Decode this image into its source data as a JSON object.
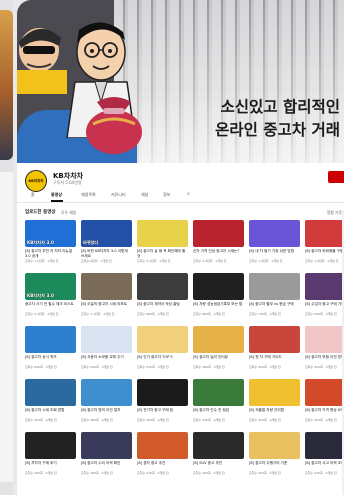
{
  "banner": {
    "headline_line1": "소신있고 합리적인",
    "headline_line2": "온라인 중고차 거래"
  },
  "channel": {
    "avatar_text": "KB차차차",
    "name": "KB차차차",
    "subtitle": "구독자 5.64만명"
  },
  "tabs": [
    {
      "label": "홈"
    },
    {
      "label": "동영상"
    },
    {
      "label": "재생목록"
    },
    {
      "label": "커뮤니티"
    },
    {
      "label": "채널"
    },
    {
      "label": "정보"
    }
  ],
  "section": {
    "title": "업로드한 동영상",
    "play_all": "모두 재생",
    "sort": "정렬 기준"
  },
  "colors": {
    "accent_red": "#cc0000",
    "avatar_yellow": "#f5c400"
  },
  "videos": [
    {
      "cap": "KB차차차 3.0",
      "title": "[8] 중고차 추천 차 차차 리뉴얼 3.0 공개",
      "meta": "조회수 1.2만회 · 1개월 전",
      "bg": "#1f6fd6"
    },
    {
      "cap": "바뀌었다",
      "title": "[8] 바뀐 KB차차차 3.0 이렇게 쓰세요",
      "meta": "조회수 8천회 · 1개월 전",
      "bg": "#2451a8"
    },
    {
      "cap": "",
      "title": "[8] 중고차 살 때 꼭 확인해야 할 것",
      "meta": "조회수 3.1천회 · 1개월 전",
      "bg": "#e8d24a"
    },
    {
      "cap": "",
      "title": "신차 가격 인상 중고차 시세는?",
      "meta": "조회수 2.4천회 · 1개월 전",
      "bg": "#b8232d"
    },
    {
      "cap": "",
      "title": "[8] 내 차 팔기 가장 쉬운 방법",
      "meta": "조회수 1.9천회 · 1개월 전",
      "bg": "#6a55d8"
    },
    {
      "cap": "",
      "title": "[8] 중고차 허위매물 구별법",
      "meta": "조회수 1.5천회 · 2개월 전",
      "bg": "#d23b3b"
    },
    {
      "cap": "KB차차차 3.0",
      "title": "중고차 사기 전 필수 체크 리스트",
      "meta": "조회수 5.2천회 · 2개월 전",
      "bg": "#1c8a5a"
    },
    {
      "cap": "",
      "title": "[8] 오늘의 중고차 시세 리포트",
      "meta": "조회수 1.1천회 · 2개월 전",
      "bg": "#7a6a58"
    },
    {
      "cap": "",
      "title": "[8] 중고차 계약서 작성 꿀팁",
      "meta": "조회수 980회 · 2개월 전",
      "bg": "#3c3c3c"
    },
    {
      "cap": "",
      "title": "[8] 차량 성능점검기록부 보는 법",
      "meta": "조회수 860회 · 2개월 전",
      "bg": "#202020"
    },
    {
      "cap": "",
      "title": "[8] 중고차 할부 vs 현금 구매",
      "meta": "조회수 740회 · 2개월 전",
      "bg": "#9a9a9a"
    },
    {
      "cap": "",
      "title": "[8] 수입차 중고 구매 가이드",
      "meta": "조회수 690회 · 3개월 전",
      "bg": "#5a3a6e"
    },
    {
      "cap": "",
      "title": "[8] 중고차 상식 퀴즈",
      "meta": "조회수 640회 · 3개월 전",
      "bg": "#2e7fd0"
    },
    {
      "cap": "",
      "title": "[8] 자동차 소모품 교체 주기",
      "meta": "조회수 590회 · 3개월 전",
      "bg": "#d9e2f0"
    },
    {
      "cap": "",
      "title": "[8] 인기 중고차 TOP 5",
      "meta": "조회수 530회 · 3개월 전",
      "bg": "#f0d07a"
    },
    {
      "cap": "",
      "title": "[8] 중고차 딜러 인터뷰",
      "meta": "조회수 480회 · 3개월 전",
      "bg": "#e7b14a"
    },
    {
      "cap": "",
      "title": "[8] 첫 차 구매 가이드",
      "meta": "조회수 450회 · 3개월 전",
      "bg": "#c9463d"
    },
    {
      "cap": "",
      "title": "[8] 중고차 보험 이전 방법",
      "meta": "조회수 420회 · 3개월 전",
      "bg": "#f1c6c6"
    },
    {
      "cap": "",
      "title": "[8] 중고차 시세 조회 방법",
      "meta": "조회수 400회 · 4개월 전",
      "bg": "#2a6a9e"
    },
    {
      "cap": "",
      "title": "[8] 중고차 명의 이전 절차",
      "meta": "조회수 380회 · 4개월 전",
      "bg": "#3f8fcf"
    },
    {
      "cap": "",
      "title": "[8] 전기차 중고 구매 팁",
      "meta": "조회수 360회 · 4개월 전",
      "bg": "#1b1b1b"
    },
    {
      "cap": "",
      "title": "[8] 중고차 인수 전 점검",
      "meta": "조회수 340회 · 4개월 전",
      "bg": "#3a7a3a"
    },
    {
      "cap": "",
      "title": "[8] 겨울철 차량 관리법",
      "meta": "조회수 320회 · 4개월 전",
      "bg": "#f0c030"
    },
    {
      "cap": "",
      "title": "[8] 중고차 가격 협상 요령",
      "meta": "조회수 300회 · 4개월 전",
      "bg": "#d24a2a"
    },
    {
      "cap": "",
      "title": "[8] 차차차 구매 후기",
      "meta": "조회수 290회 · 5개월 전",
      "bg": "#222222"
    },
    {
      "cap": "",
      "title": "[8] 중고차 수리 이력 확인",
      "meta": "조회수 280회 · 5개월 전",
      "bg": "#3a3a5a"
    },
    {
      "cap": "",
      "title": "[8] 경차 중고 추천",
      "meta": "조회수 270회 · 5개월 전",
      "bg": "#d05a2a"
    },
    {
      "cap": "",
      "title": "[8] SUV 중고 추천",
      "meta": "조회수 260회 · 5개월 전",
      "bg": "#2a2a2a"
    },
    {
      "cap": "",
      "title": "[8] 중고차 주행거리 기준",
      "meta": "조회수 250회 · 5개월 전",
      "bg": "#e8c060"
    },
    {
      "cap": "",
      "title": "[8] 중고차 사고 이력 조회",
      "meta": "조회수 240회 · 5개월 전",
      "bg": "#2a2a3a"
    }
  ]
}
